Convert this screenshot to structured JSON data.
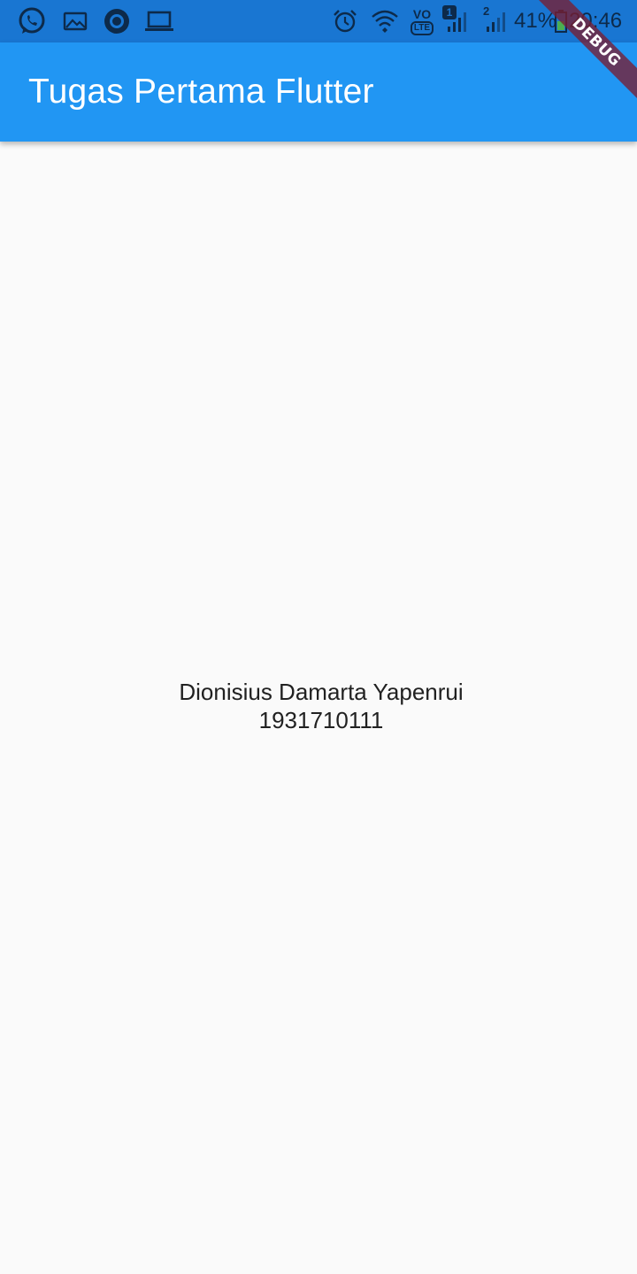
{
  "status_bar": {
    "left_icons": [
      "whatsapp-icon",
      "gallery-icon",
      "circle-app-icon",
      "laptop-icon"
    ],
    "right_icons": [
      "alarm-icon",
      "wifi-icon",
      "volte-icon",
      "signal-sim1-icon",
      "signal-sim2-icon",
      "battery-icon"
    ],
    "volte_label": "VO",
    "lte_label": "LTE",
    "sim1_label": "1",
    "sim2_label": "2",
    "battery_percent": "41%",
    "time": "20:46"
  },
  "app_bar": {
    "title": "Tugas Pertama Flutter",
    "color": "#2196f3"
  },
  "body": {
    "name": "Dionisius Damarta Yapenrui",
    "student_id": "1931710111"
  },
  "debug_banner": {
    "label": "DEBUG"
  }
}
